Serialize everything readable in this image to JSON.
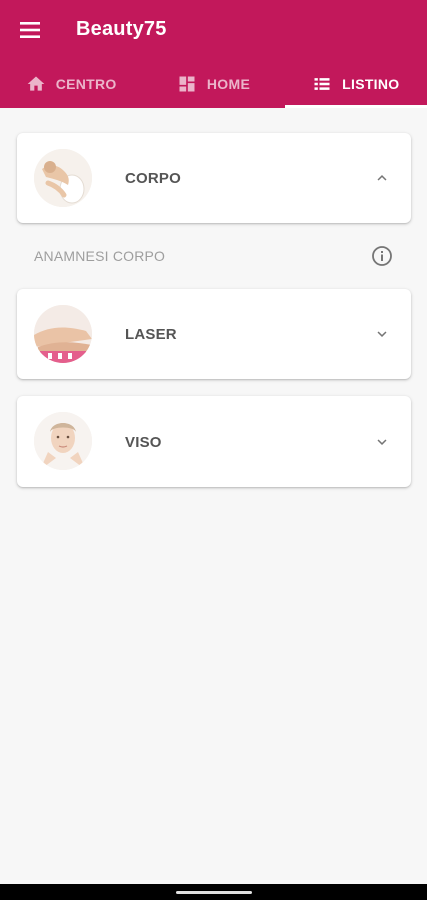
{
  "app": {
    "title": "Beauty75",
    "accent_color": "#c2185b"
  },
  "tabs": [
    {
      "label": "CENTRO",
      "icon": "home-icon",
      "active": false
    },
    {
      "label": "HOME",
      "icon": "dashboard-icon",
      "active": false
    },
    {
      "label": "LISTINO",
      "icon": "list-icon",
      "active": true
    }
  ],
  "categories": [
    {
      "label": "CORPO",
      "icon": "chevron-up-icon",
      "expanded": true
    },
    {
      "label": "LASER",
      "icon": "chevron-down-icon",
      "expanded": false
    },
    {
      "label": "VISO",
      "icon": "chevron-down-icon",
      "expanded": false
    }
  ],
  "corpo_section": {
    "label": "ANAMNESI CORPO",
    "icon": "info-icon"
  }
}
